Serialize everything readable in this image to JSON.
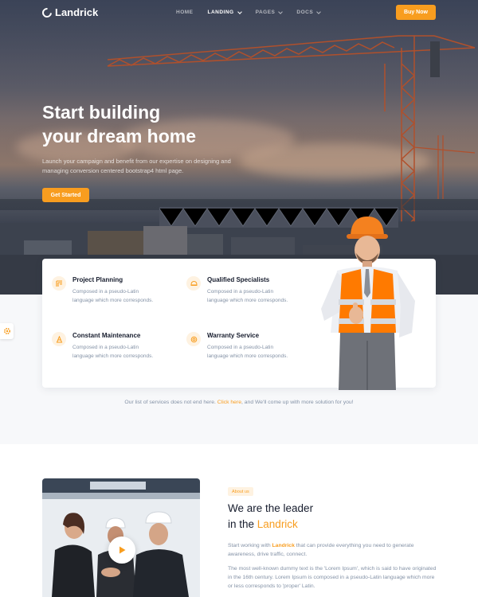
{
  "brand": {
    "name": "Landrick",
    "accent": "#f89d1f"
  },
  "nav": {
    "items": [
      {
        "label": "HOME",
        "dropdown": false
      },
      {
        "label": "LANDING",
        "dropdown": true
      },
      {
        "label": "PAGES",
        "dropdown": true
      },
      {
        "label": "DOCS",
        "dropdown": true
      }
    ],
    "active": "LANDING",
    "buy_label": "Buy Now"
  },
  "hero": {
    "title_line1": "Start building",
    "title_line2": "your dream home",
    "subtitle": "Launch your campaign and benefit from our expertise on designing and managing conversion centered bootstrap4 html page.",
    "cta_label": "Get Started"
  },
  "features": [
    {
      "title": "Project Planning",
      "desc": "Composed in a pseudo-Latin language which more corresponds.",
      "icon": "planning-icon"
    },
    {
      "title": "Qualified Specialists",
      "desc": "Composed in a pseudo-Latin language which more corresponds.",
      "icon": "helmet-icon"
    },
    {
      "title": "Constant Maintenance",
      "desc": "Composed in a pseudo-Latin language which more corresponds.",
      "icon": "cone-icon"
    },
    {
      "title": "Warranty Service",
      "desc": "Composed in a pseudo-Latin language which more corresponds.",
      "icon": "shield-icon"
    }
  ],
  "services_note": {
    "before": "Our list of services does not end here. ",
    "link": "Click here",
    "after": ", and We'll come up with more solution for you!"
  },
  "about": {
    "badge": "About us",
    "title_line1": "We are the leader",
    "title_line2_prefix": "in the ",
    "title_line2_accent": "Landrick",
    "p1_before": "Start working with ",
    "p1_accent": "Landrick",
    "p1_after": " that can provide everything you need to generate awareness, drive traffic, connect.",
    "p2": "The most well-known dummy text is the 'Lorem Ipsum', which is said to have originated in the 16th century. Lorem Ipsum is composed in a pseudo-Latin language which more or less corresponds to 'proper' Latin."
  }
}
